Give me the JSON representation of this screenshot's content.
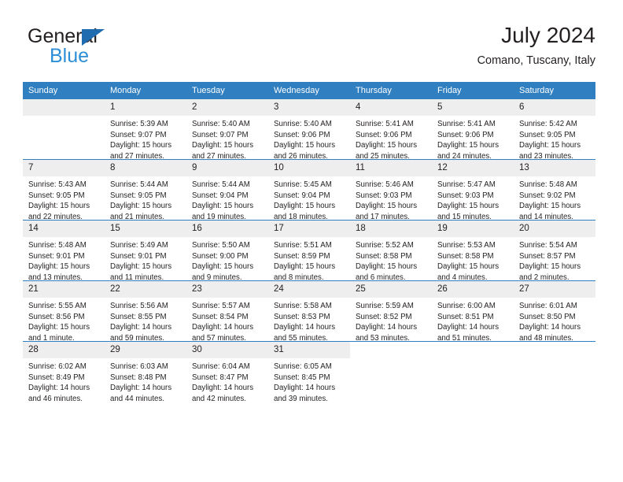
{
  "logo": {
    "word_dark": "General",
    "word_blue": "Blue",
    "triangle_color": "#1f6cb0",
    "blue_color": "#2c8fd6"
  },
  "header": {
    "title": "July 2024",
    "subtitle": "Comano, Tuscany, Italy",
    "header_bg": "#2f7fc1",
    "daynum_bg": "#eeeeee"
  },
  "calendar": {
    "weekday_headers": [
      "Sunday",
      "Monday",
      "Tuesday",
      "Wednesday",
      "Thursday",
      "Friday",
      "Saturday"
    ],
    "weeks": [
      [
        {
          "day": "",
          "blank": true,
          "lines": []
        },
        {
          "day": "1",
          "lines": [
            "Sunrise: 5:39 AM",
            "Sunset: 9:07 PM",
            "Daylight: 15 hours",
            "and 27 minutes."
          ]
        },
        {
          "day": "2",
          "lines": [
            "Sunrise: 5:40 AM",
            "Sunset: 9:07 PM",
            "Daylight: 15 hours",
            "and 27 minutes."
          ]
        },
        {
          "day": "3",
          "lines": [
            "Sunrise: 5:40 AM",
            "Sunset: 9:06 PM",
            "Daylight: 15 hours",
            "and 26 minutes."
          ]
        },
        {
          "day": "4",
          "lines": [
            "Sunrise: 5:41 AM",
            "Sunset: 9:06 PM",
            "Daylight: 15 hours",
            "and 25 minutes."
          ]
        },
        {
          "day": "5",
          "lines": [
            "Sunrise: 5:41 AM",
            "Sunset: 9:06 PM",
            "Daylight: 15 hours",
            "and 24 minutes."
          ]
        },
        {
          "day": "6",
          "lines": [
            "Sunrise: 5:42 AM",
            "Sunset: 9:05 PM",
            "Daylight: 15 hours",
            "and 23 minutes."
          ]
        }
      ],
      [
        {
          "day": "7",
          "lines": [
            "Sunrise: 5:43 AM",
            "Sunset: 9:05 PM",
            "Daylight: 15 hours",
            "and 22 minutes."
          ]
        },
        {
          "day": "8",
          "lines": [
            "Sunrise: 5:44 AM",
            "Sunset: 9:05 PM",
            "Daylight: 15 hours",
            "and 21 minutes."
          ]
        },
        {
          "day": "9",
          "lines": [
            "Sunrise: 5:44 AM",
            "Sunset: 9:04 PM",
            "Daylight: 15 hours",
            "and 19 minutes."
          ]
        },
        {
          "day": "10",
          "lines": [
            "Sunrise: 5:45 AM",
            "Sunset: 9:04 PM",
            "Daylight: 15 hours",
            "and 18 minutes."
          ]
        },
        {
          "day": "11",
          "lines": [
            "Sunrise: 5:46 AM",
            "Sunset: 9:03 PM",
            "Daylight: 15 hours",
            "and 17 minutes."
          ]
        },
        {
          "day": "12",
          "lines": [
            "Sunrise: 5:47 AM",
            "Sunset: 9:03 PM",
            "Daylight: 15 hours",
            "and 15 minutes."
          ]
        },
        {
          "day": "13",
          "lines": [
            "Sunrise: 5:48 AM",
            "Sunset: 9:02 PM",
            "Daylight: 15 hours",
            "and 14 minutes."
          ]
        }
      ],
      [
        {
          "day": "14",
          "lines": [
            "Sunrise: 5:48 AM",
            "Sunset: 9:01 PM",
            "Daylight: 15 hours",
            "and 13 minutes."
          ]
        },
        {
          "day": "15",
          "lines": [
            "Sunrise: 5:49 AM",
            "Sunset: 9:01 PM",
            "Daylight: 15 hours",
            "and 11 minutes."
          ]
        },
        {
          "day": "16",
          "lines": [
            "Sunrise: 5:50 AM",
            "Sunset: 9:00 PM",
            "Daylight: 15 hours",
            "and 9 minutes."
          ]
        },
        {
          "day": "17",
          "lines": [
            "Sunrise: 5:51 AM",
            "Sunset: 8:59 PM",
            "Daylight: 15 hours",
            "and 8 minutes."
          ]
        },
        {
          "day": "18",
          "lines": [
            "Sunrise: 5:52 AM",
            "Sunset: 8:58 PM",
            "Daylight: 15 hours",
            "and 6 minutes."
          ]
        },
        {
          "day": "19",
          "lines": [
            "Sunrise: 5:53 AM",
            "Sunset: 8:58 PM",
            "Daylight: 15 hours",
            "and 4 minutes."
          ]
        },
        {
          "day": "20",
          "lines": [
            "Sunrise: 5:54 AM",
            "Sunset: 8:57 PM",
            "Daylight: 15 hours",
            "and 2 minutes."
          ]
        }
      ],
      [
        {
          "day": "21",
          "lines": [
            "Sunrise: 5:55 AM",
            "Sunset: 8:56 PM",
            "Daylight: 15 hours",
            "and 1 minute."
          ]
        },
        {
          "day": "22",
          "lines": [
            "Sunrise: 5:56 AM",
            "Sunset: 8:55 PM",
            "Daylight: 14 hours",
            "and 59 minutes."
          ]
        },
        {
          "day": "23",
          "lines": [
            "Sunrise: 5:57 AM",
            "Sunset: 8:54 PM",
            "Daylight: 14 hours",
            "and 57 minutes."
          ]
        },
        {
          "day": "24",
          "lines": [
            "Sunrise: 5:58 AM",
            "Sunset: 8:53 PM",
            "Daylight: 14 hours",
            "and 55 minutes."
          ]
        },
        {
          "day": "25",
          "lines": [
            "Sunrise: 5:59 AM",
            "Sunset: 8:52 PM",
            "Daylight: 14 hours",
            "and 53 minutes."
          ]
        },
        {
          "day": "26",
          "lines": [
            "Sunrise: 6:00 AM",
            "Sunset: 8:51 PM",
            "Daylight: 14 hours",
            "and 51 minutes."
          ]
        },
        {
          "day": "27",
          "lines": [
            "Sunrise: 6:01 AM",
            "Sunset: 8:50 PM",
            "Daylight: 14 hours",
            "and 48 minutes."
          ]
        }
      ],
      [
        {
          "day": "28",
          "lines": [
            "Sunrise: 6:02 AM",
            "Sunset: 8:49 PM",
            "Daylight: 14 hours",
            "and 46 minutes."
          ]
        },
        {
          "day": "29",
          "lines": [
            "Sunrise: 6:03 AM",
            "Sunset: 8:48 PM",
            "Daylight: 14 hours",
            "and 44 minutes."
          ]
        },
        {
          "day": "30",
          "lines": [
            "Sunrise: 6:04 AM",
            "Sunset: 8:47 PM",
            "Daylight: 14 hours",
            "and 42 minutes."
          ]
        },
        {
          "day": "31",
          "lines": [
            "Sunrise: 6:05 AM",
            "Sunset: 8:45 PM",
            "Daylight: 14 hours",
            "and 39 minutes."
          ]
        },
        {
          "day": "",
          "blank": true,
          "nobg": true,
          "lines": []
        },
        {
          "day": "",
          "blank": true,
          "nobg": true,
          "lines": []
        },
        {
          "day": "",
          "blank": true,
          "nobg": true,
          "lines": []
        }
      ]
    ]
  }
}
